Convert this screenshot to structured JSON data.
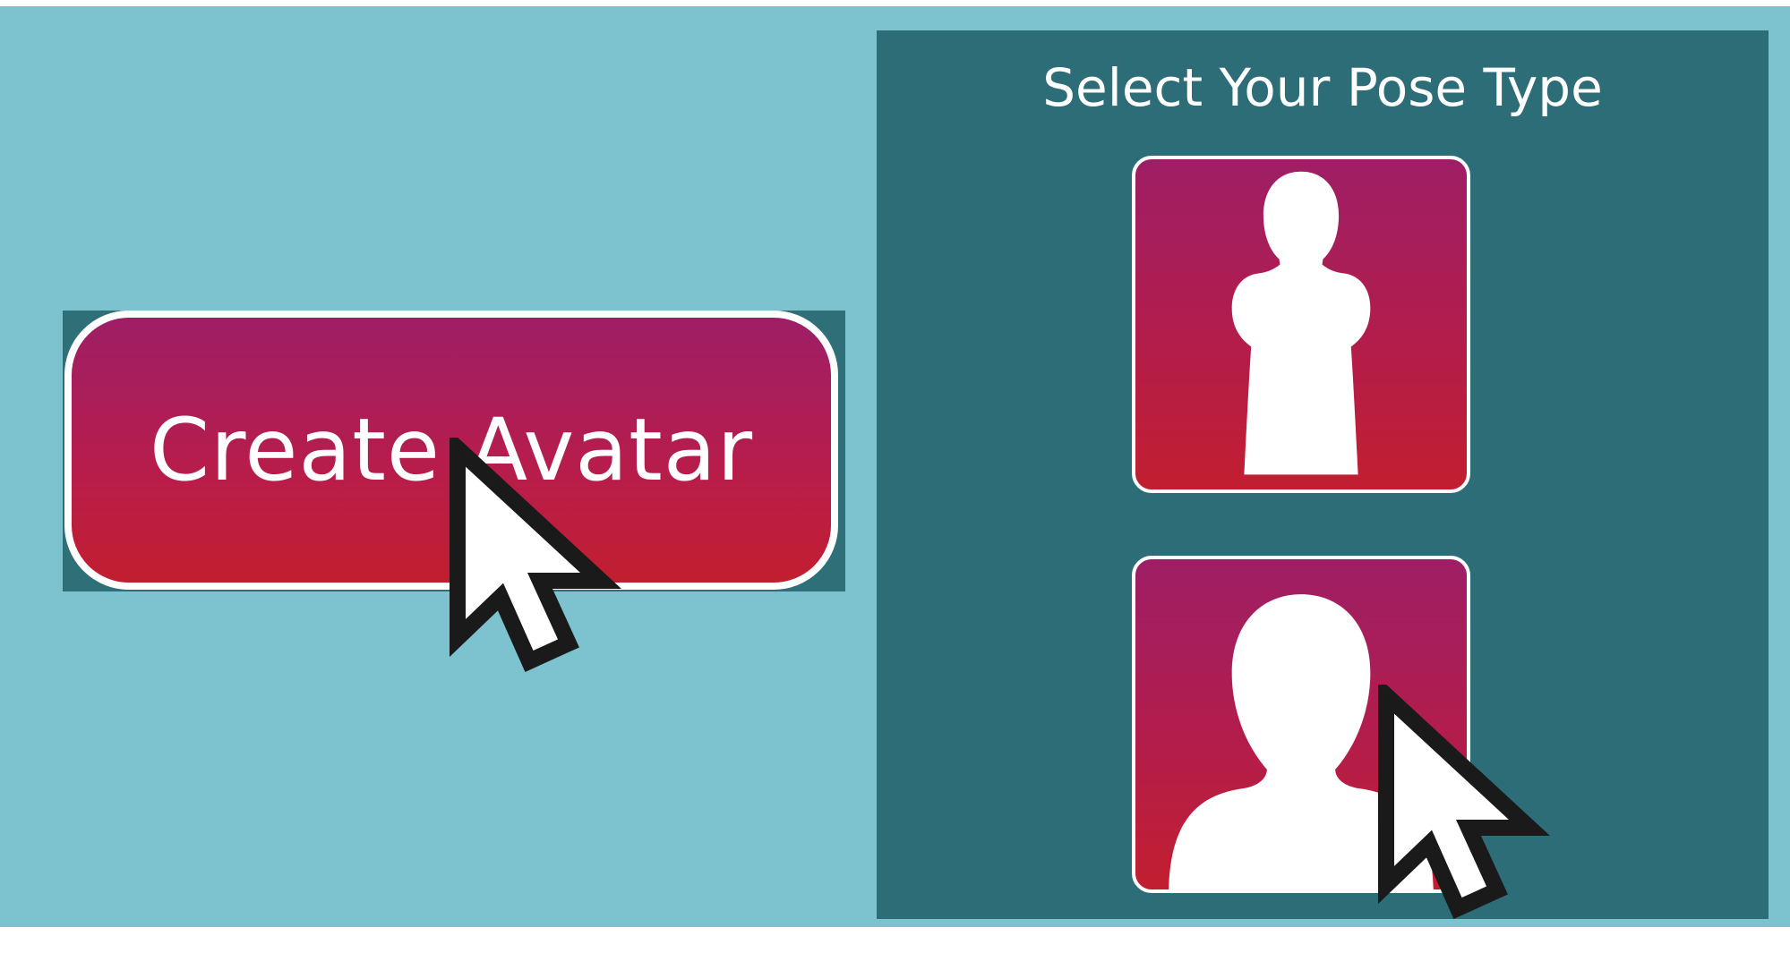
{
  "create_button": {
    "label": "Create Avatar"
  },
  "pose_panel": {
    "title": "Select Your Pose Type",
    "options": [
      {
        "icon": "full-body-silhouette-icon"
      },
      {
        "icon": "head-shoulders-silhouette-icon"
      }
    ]
  },
  "cursors": [
    "mouse-pointer-icon",
    "mouse-pointer-icon"
  ],
  "colors": {
    "background": "#7cc3cf",
    "panel": "#2d6d78",
    "button_top": "#9e1e66",
    "button_bottom": "#c21e30",
    "text": "#ffffff"
  }
}
